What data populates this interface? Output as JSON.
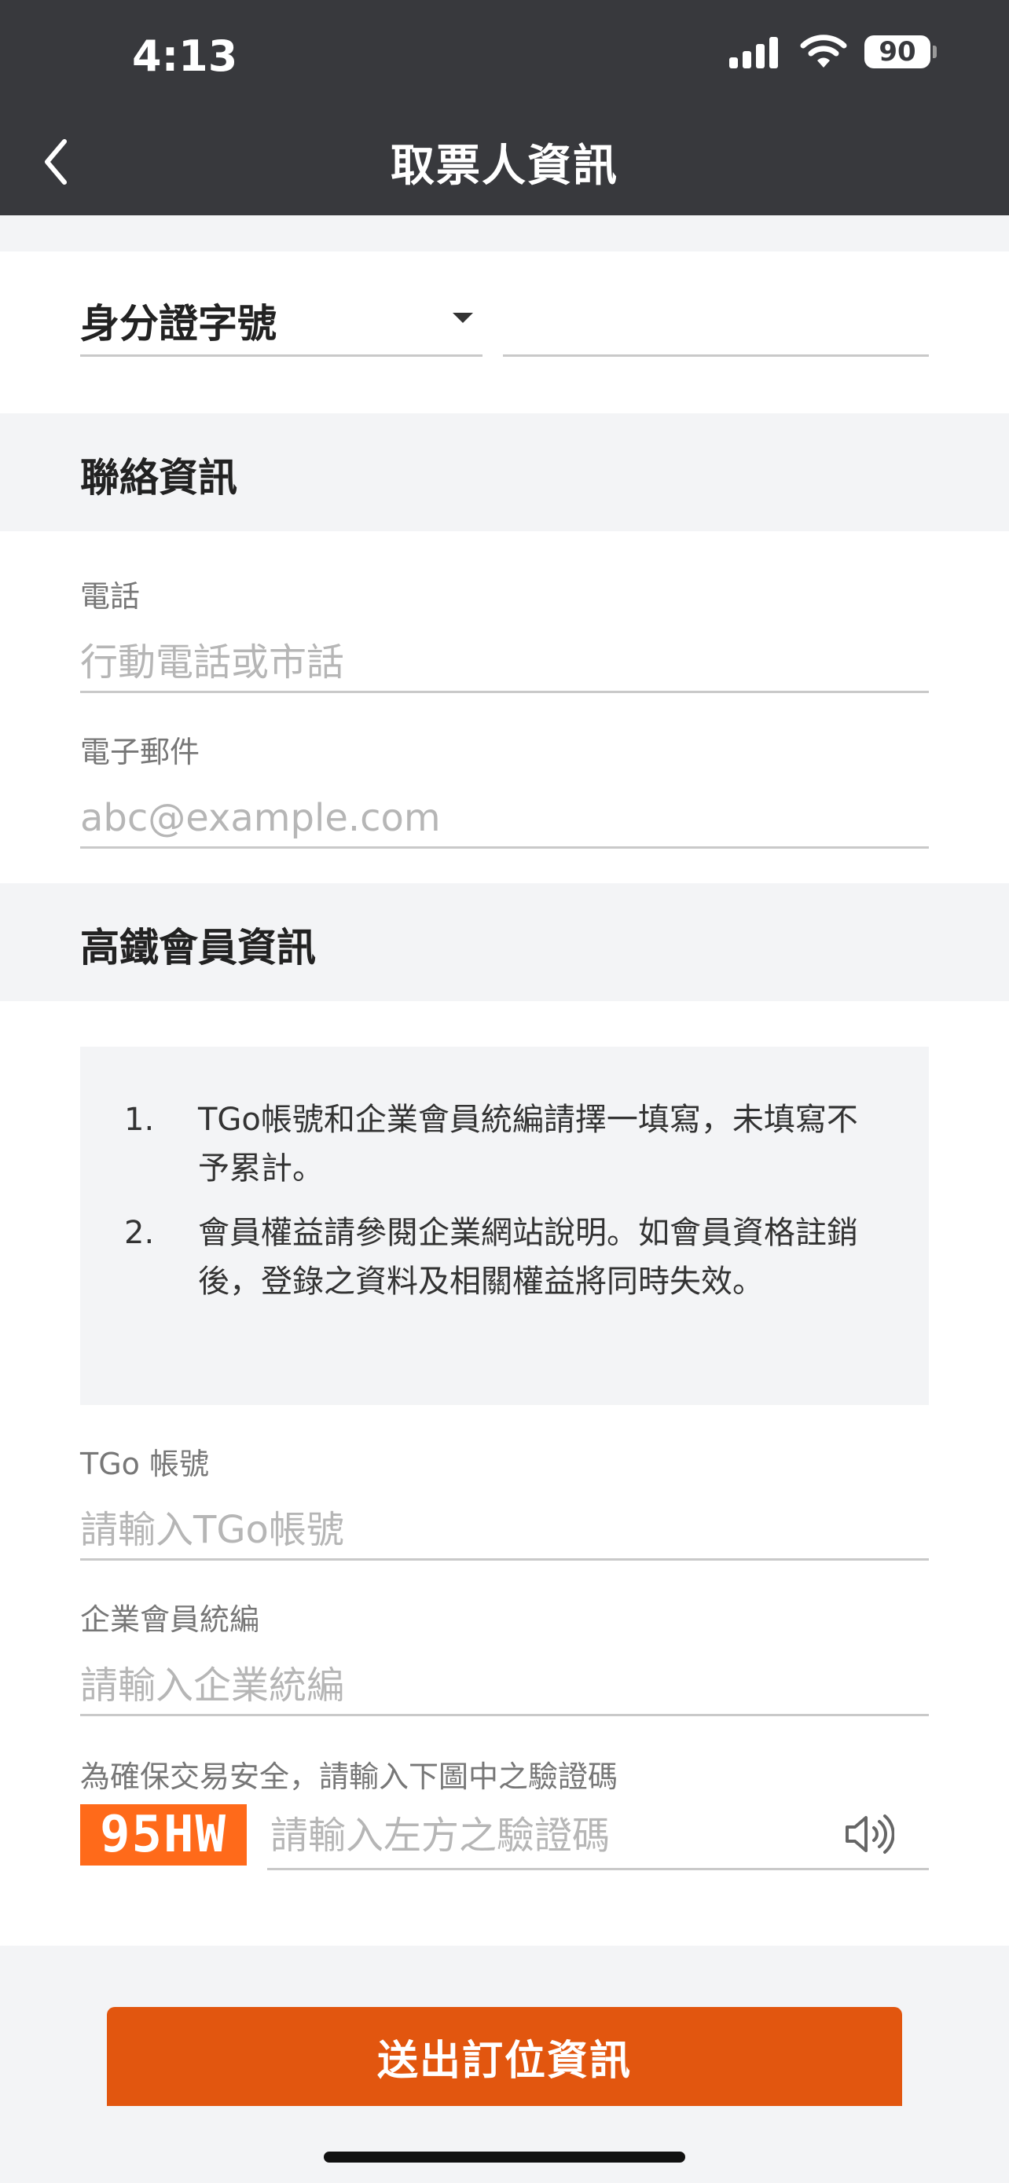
{
  "status_bar": {
    "time": "4:13",
    "battery": "90"
  },
  "header": {
    "title": "取票人資訊"
  },
  "id_section": {
    "type_label": "身分證字號",
    "id_value": ""
  },
  "contact": {
    "title": "聯絡資訊",
    "phone_label": "電話",
    "phone_placeholder": "行動電話或市話",
    "email_label": "電子郵件",
    "email_placeholder": "abc@example.com"
  },
  "member": {
    "title": "高鐵會員資訊",
    "notices": [
      {
        "num": "1.",
        "text": "TGo帳號和企業會員統編請擇一填寫，未填寫不予累計。"
      },
      {
        "num": "2.",
        "text": "會員權益請參閱企業網站說明。如會員資格註銷後，登錄之資料及相關權益將同時失效。"
      }
    ],
    "tgo_label": "TGo 帳號",
    "tgo_placeholder": "請輸入TGo帳號",
    "corp_label": "企業會員統編",
    "corp_placeholder": "請輸入企業統編"
  },
  "captcha": {
    "label": "為確保交易安全，請輸入下圖中之驗證碼",
    "code": "95HW",
    "placeholder": "請輸入左方之驗證碼"
  },
  "submit_label": "送出訂位資訊",
  "colors": {
    "header_bg": "#38393d",
    "accent": "#e2560f",
    "captcha_bg": "#ff6a1a"
  }
}
